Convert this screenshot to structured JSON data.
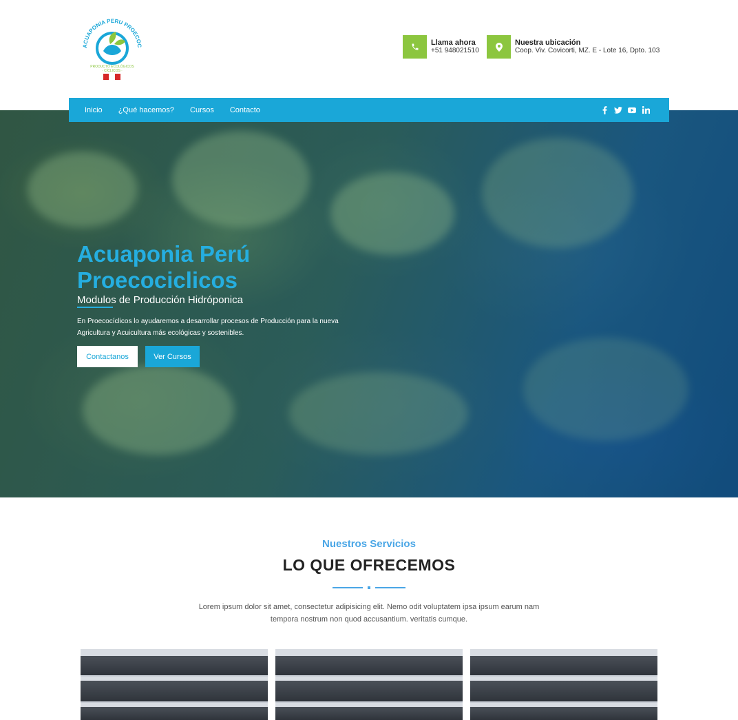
{
  "brand": {
    "logo_text_top": "ACUAPONIA PERU PROECOCICLICOS",
    "logo_text_bottom": "PRODUCTO ECOLÓGICOS · CÍCLICOS ·"
  },
  "contact": {
    "phone_title": "Llama ahora",
    "phone_value": "+51 948021510",
    "location_title": "Nuestra ubicación",
    "location_value": "Coop. Viv. Covicorti, MZ. E - Lote 16, Dpto. 103"
  },
  "nav": {
    "items": [
      "Inicio",
      "¿Qué hacemos?",
      "Cursos",
      "Contacto"
    ],
    "social": [
      "facebook-icon",
      "twitter-icon",
      "youtube-icon",
      "linkedin-icon"
    ]
  },
  "hero": {
    "title_line1": "Acuaponia Perú",
    "title_line2": "Proecociclicos",
    "subtitle": "Modulos de Producción Hidróponica",
    "description": "En Proecocíclicos lo ayudaremos a desarrollar procesos de Producción para la nueva Agricultura y Acuicultura más ecológicas y sostenibles.",
    "cta_primary": "Contactanos",
    "cta_secondary": "Ver Cursos"
  },
  "services": {
    "kicker": "Nuestros Servicios",
    "title": "LO QUE OFRECEMOS",
    "description": "Lorem ipsum dolor sit amet, consectetur adipisicing elit. Nemo odit voluptatem ipsa ipsum earum nam tempora nostrum non quod accusantium. veritatis cumque."
  },
  "colors": {
    "accent_blue": "#1aa7d8",
    "accent_green": "#8cc63f",
    "title_blue": "#25aee0"
  }
}
